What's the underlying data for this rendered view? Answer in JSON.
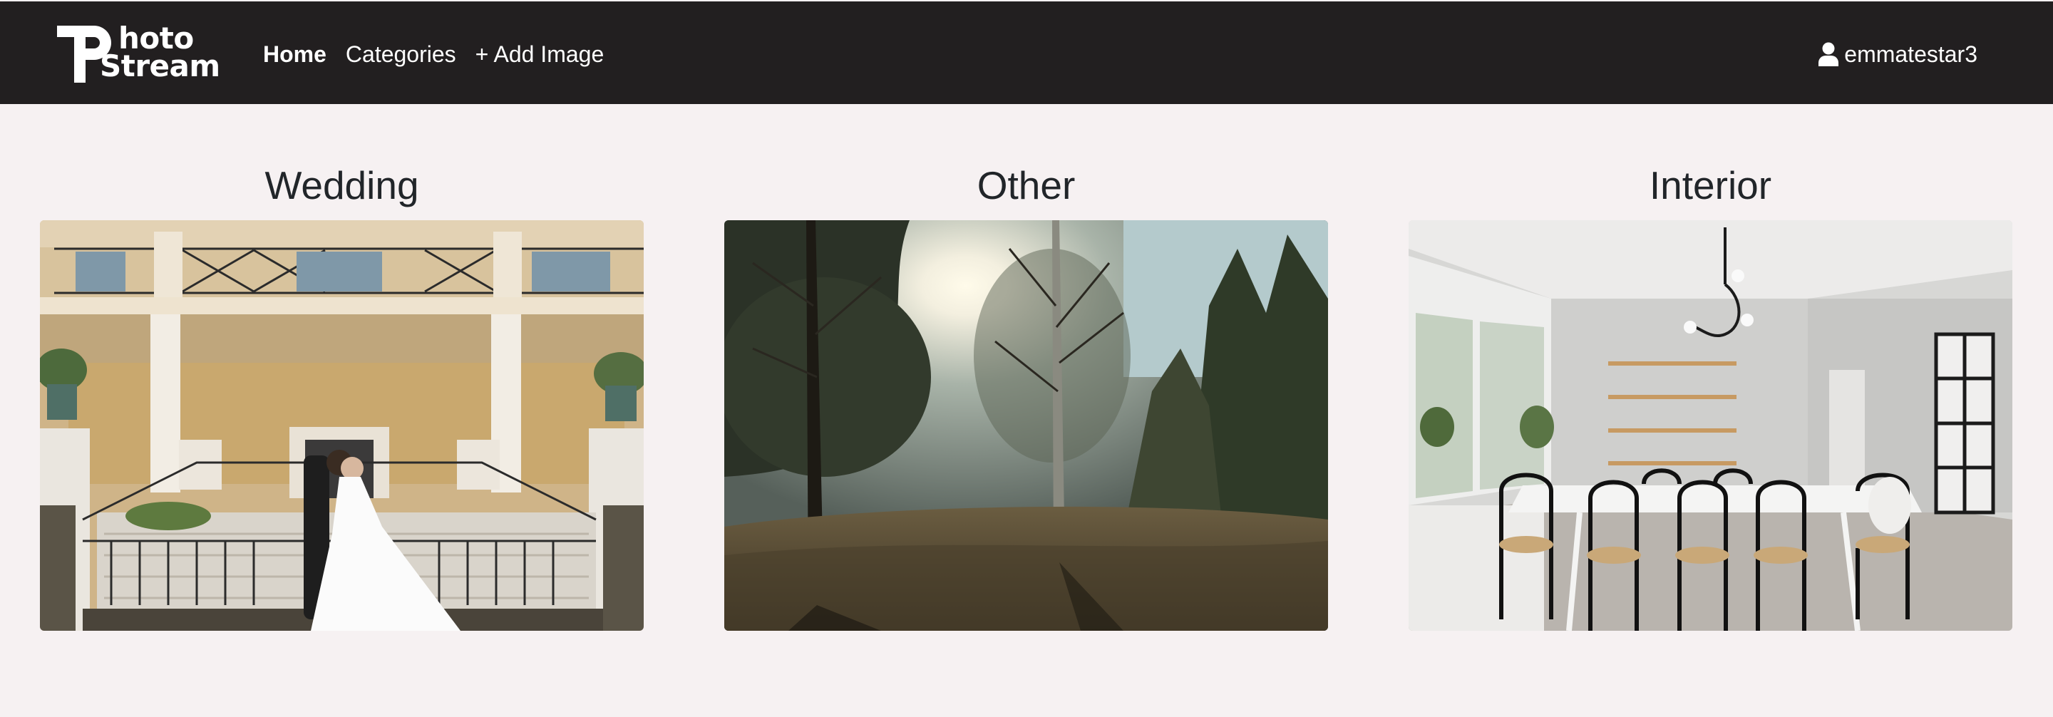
{
  "brand": {
    "line1": "hoto",
    "line2": "Stream",
    "logo_icon": "photostream-p-logo"
  },
  "nav": {
    "items": [
      {
        "label": "Home",
        "active": true
      },
      {
        "label": "Categories",
        "active": false
      },
      {
        "label": "+ Add Image",
        "active": false
      }
    ]
  },
  "user": {
    "icon": "user-icon",
    "name": "emmatestar3"
  },
  "categories": [
    {
      "title": "Wedding",
      "image": "wedding couple on mansion stairs"
    },
    {
      "title": "Other",
      "image": "sunlit forest meadow"
    },
    {
      "title": "Interior",
      "image": "white dining room interior"
    }
  ],
  "colors": {
    "navbar": "#221f20",
    "background": "#f6f1f2",
    "text": "#212529"
  }
}
